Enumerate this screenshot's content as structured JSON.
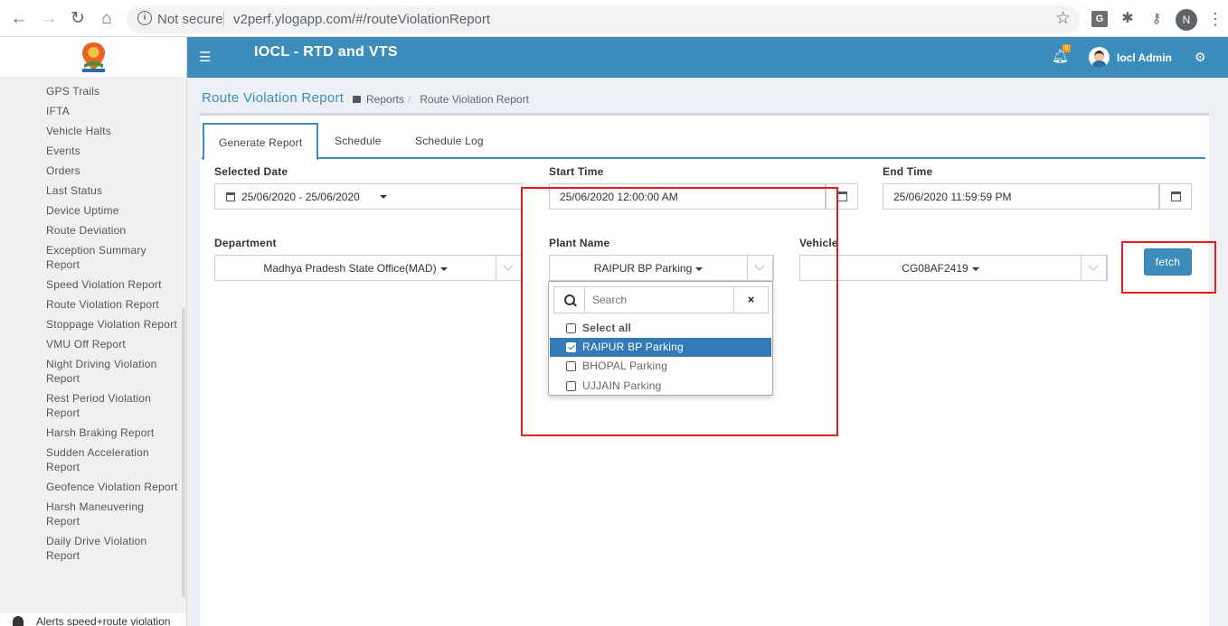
{
  "browser": {
    "security_label": "Not secure",
    "url": "v2perf.ylogapp.com/#/routeViolationReport",
    "ext_g": "G",
    "profile_initial": "N"
  },
  "sidebar": {
    "items": [
      "GPS Trails",
      "IFTA",
      "Vehicle Halts",
      "Events",
      "Orders",
      "Last Status",
      "Device Uptime",
      "Route Deviation",
      "Exception Summary Report",
      "Speed Violation Report",
      "Route Violation Report",
      "Stoppage Violation Report",
      "VMU Off Report",
      "Night Driving Violation Report",
      "Rest Period Violation Report",
      "Harsh Braking Report",
      "Sudden Acceleration Report",
      "Geofence Violation Report",
      "Harsh Maneuvering Report",
      "Daily Drive Violation Report"
    ],
    "bottom_item": "Alerts speed+route violation"
  },
  "topbar": {
    "title": "IOCL - RTD and VTS",
    "notification_count": "0",
    "user_name": "Iocl Admin"
  },
  "page": {
    "title": "Route Violation Report",
    "breadcrumb_parent": "Reports",
    "breadcrumb_sep": "/",
    "breadcrumb_current": "Route Violation Report"
  },
  "tabs": {
    "generate": "Generate Report",
    "schedule": "Schedule",
    "schedule_log": "Schedule Log"
  },
  "form": {
    "selected_date_label": "Selected Date",
    "selected_date_value": "25/06/2020 - 25/06/2020",
    "start_time_label": "Start Time",
    "start_time_value": "25/06/2020 12:00:00 AM",
    "end_time_label": "End Time",
    "end_time_value": "25/06/2020 11:59:59 PM",
    "department_label": "Department",
    "department_value": "Madhya Pradesh State Office(MAD)",
    "plant_label": "Plant Name",
    "plant_value": "RAIPUR BP Parking",
    "vehicle_label": "Vehicle",
    "vehicle_value": "CG08AF2419",
    "fetch_label": "fetch"
  },
  "plant_menu": {
    "search_placeholder": "Search",
    "clear_icon": "×",
    "select_all": "Select all",
    "options": [
      "RAIPUR BP Parking",
      "BHOPAL Parking",
      "UJJAIN Parking"
    ],
    "selected": "RAIPUR BP Parking"
  },
  "colors": {
    "primary": "#3c8dbc",
    "annotation_red": "#e21b23",
    "selected_option": "#337ab7"
  }
}
